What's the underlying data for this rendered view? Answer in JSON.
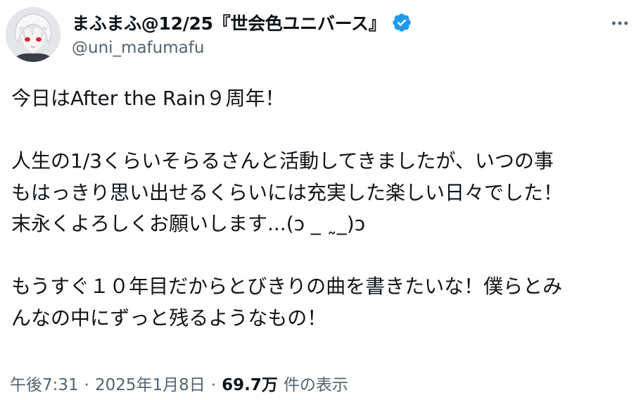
{
  "author": {
    "display_name": "まふまふ@12/25『世会色ユニバース』",
    "handle": "@uni_mafumafu",
    "avatar_icon": "user-avatar-icon",
    "verified_icon": "verified-badge-icon",
    "verified_color": "#1d9bf0"
  },
  "more_icon": "more-options-icon",
  "tweet": {
    "lines": [
      "今日はAfter the Rain９周年！",
      "人生の1/3くらいそらるさんと活動してきましたが、いつの事",
      "もはっきり思い出せるくらいには充実した楽しい日々でした！",
      "末永くよろしくお願いします...(ɔ _ ˷_)ɔ",
      "もうすぐ１０年目だからとびきりの曲を書きたいな！僕らとみ",
      "んなの中にずっと残るようなもの！"
    ]
  },
  "meta": {
    "time": "午後7:31",
    "separator": "·",
    "date": "2025年1月8日",
    "views": "69.7万",
    "views_label": "件の表示"
  }
}
